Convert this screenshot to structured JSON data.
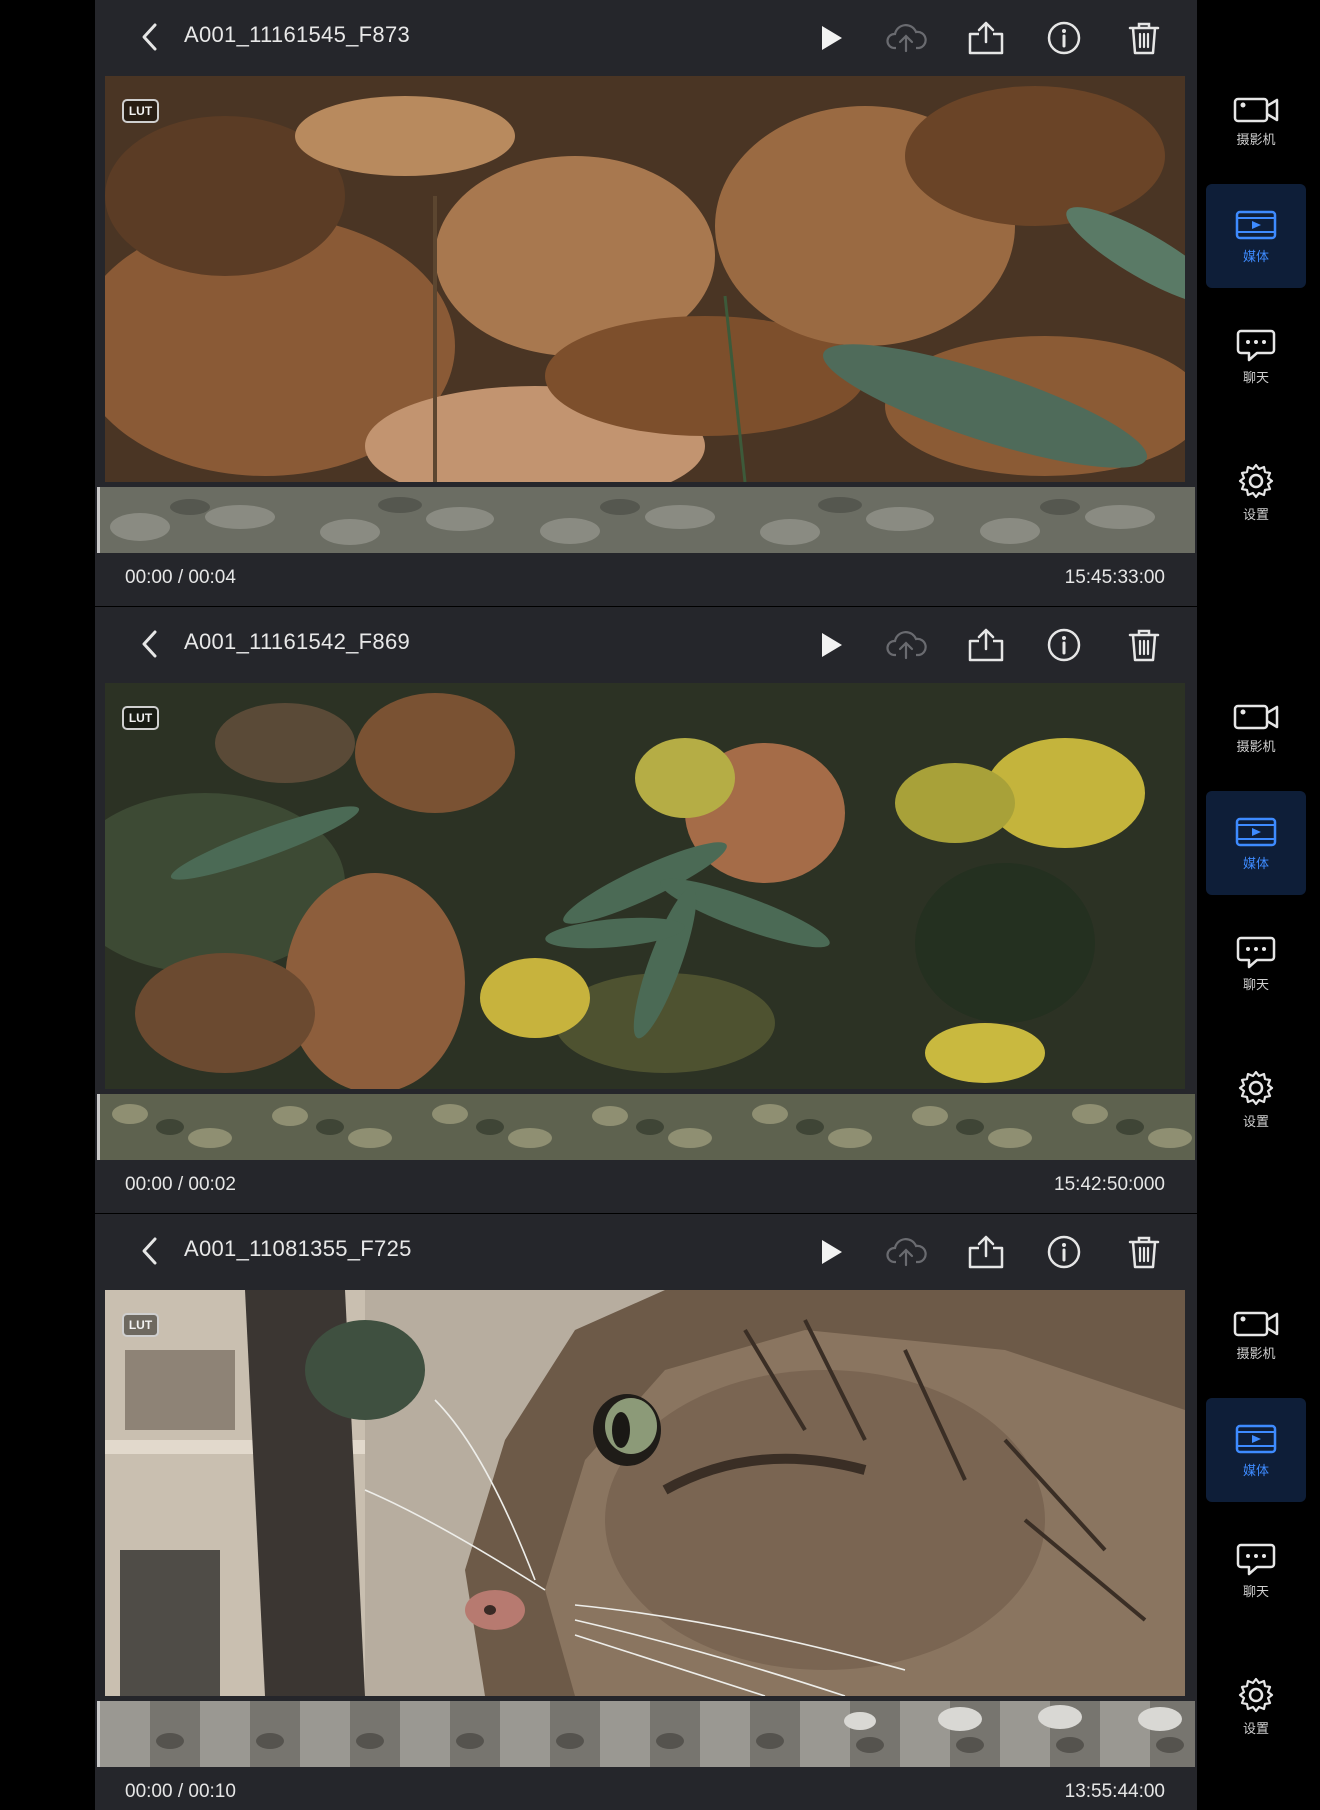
{
  "clips": [
    {
      "title": "A001_11161545_F873",
      "lut_label": "LUT",
      "time_progress": "00:00 / 00:04",
      "timecode": "15:45:33:00",
      "scene": "leaves"
    },
    {
      "title": "A001_11161542_F869",
      "lut_label": "LUT",
      "time_progress": "00:00 / 00:02",
      "timecode": "15:42:50:000",
      "scene": "plants"
    },
    {
      "title": "A001_11081355_F725",
      "lut_label": "LUT",
      "time_progress": "00:00 / 00:10",
      "timecode": "13:55:44:00",
      "scene": "cat"
    }
  ],
  "sidebar": {
    "items": [
      {
        "label": "摄影机",
        "icon": "camera-icon",
        "active": false
      },
      {
        "label": "媒体",
        "icon": "media-icon",
        "active": true
      },
      {
        "label": "聊天",
        "icon": "chat-icon",
        "active": false
      },
      {
        "label": "设置",
        "icon": "settings-icon",
        "active": false
      }
    ]
  },
  "toolbar_icons": [
    "play-icon",
    "cloud-upload-icon",
    "share-icon",
    "info-icon",
    "trash-icon"
  ],
  "colors": {
    "panel_bg": "#25262b",
    "background": "#000000",
    "accent": "#3e8bff",
    "active_nav_bg": "#0e1e38"
  }
}
